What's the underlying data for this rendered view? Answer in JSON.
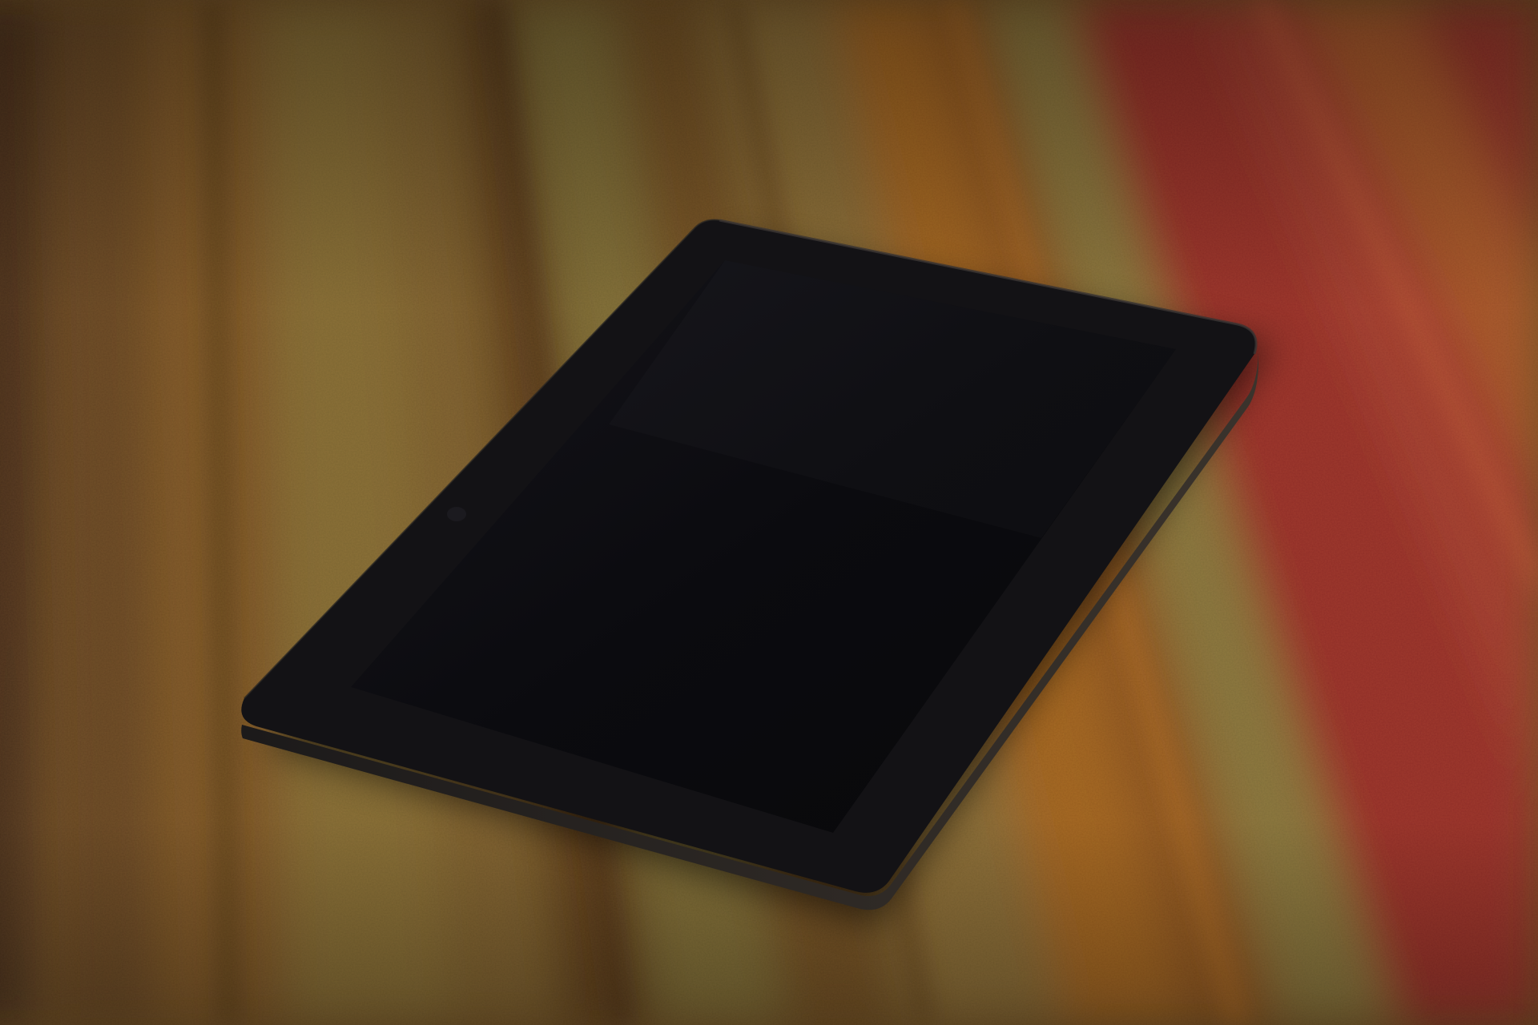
{
  "scene": {
    "subject": "tablet-device",
    "surface": "striped-carpet",
    "screen_state": "off"
  },
  "colors": {
    "carpet_base": "#7a5424",
    "carpet_dark_brown": "#4e3015",
    "carpet_olive": "#8f7a3a",
    "carpet_tan": "#a88a4c",
    "carpet_orange": "#c8741f",
    "carpet_red": "#b8262d",
    "carpet_deep_red": "#8e1a24",
    "tablet_bezel": "#131215",
    "tablet_edge": "#2a2622",
    "tablet_screen": "#0a0a0d"
  }
}
